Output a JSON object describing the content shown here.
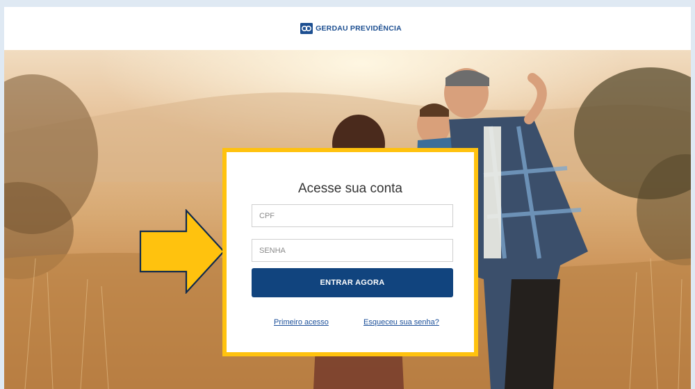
{
  "header": {
    "brand_name": "GERDAU PREVIDÊNCIA",
    "logo_icon": "chain-link-icon",
    "brand_color": "#1d4f91"
  },
  "login": {
    "title": "Acesse sua conta",
    "cpf_placeholder": "CPF",
    "cpf_value": "",
    "password_placeholder": "SENHA",
    "password_value": "",
    "submit_label": "ENTRAR AGORA",
    "first_access_link": "Primeiro acesso",
    "forgot_password_link": "Esqueceu sua senha?"
  },
  "annotation": {
    "icon": "arrow-right-icon",
    "color": "#ffc20e",
    "highlight_color": "#ffc20e"
  },
  "theme": {
    "button_color": "#11447e",
    "link_color": "#1b4f99"
  }
}
